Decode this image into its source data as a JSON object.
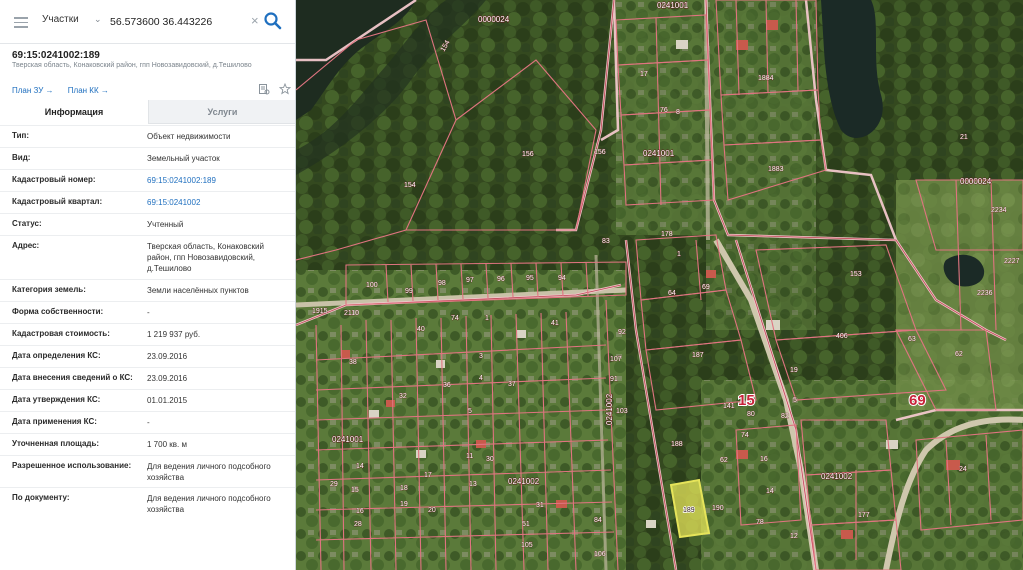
{
  "search": {
    "type_label": "Участки",
    "query": "56.573600 36.443226"
  },
  "object": {
    "cadastral_number": "69:15:0241002:189",
    "address_short": "Тверская область, Конаковский район, гпп Новозавидовский, д.Тешилово"
  },
  "links": {
    "plan_zu": "План ЗУ →",
    "plan_kk": "План КК →"
  },
  "tabs": {
    "info": "Информация",
    "services": "Услуги"
  },
  "info_rows": [
    {
      "label": "Тип:",
      "value": "Объект недвижимости",
      "link": false
    },
    {
      "label": "Вид:",
      "value": "Земельный участок",
      "link": false
    },
    {
      "label": "Кадастровый номер:",
      "value": "69:15:0241002:189",
      "link": true
    },
    {
      "label": "Кадастровый квартал:",
      "value": "69:15:0241002",
      "link": true
    },
    {
      "label": "Статус:",
      "value": "Учтенный",
      "link": false
    },
    {
      "label": "Адрес:",
      "value": "Тверская область, Конаковский район, гпп Новозавидовский, д.Тешилово",
      "link": false
    },
    {
      "label": "Категория земель:",
      "value": "Земли населённых пунктов",
      "link": false
    },
    {
      "label": "Форма собственности:",
      "value": "-",
      "link": false
    },
    {
      "label": "Кадастровая стоимость:",
      "value": "1 219 937 руб.",
      "link": false
    },
    {
      "label": "Дата определения КС:",
      "value": "23.09.2016",
      "link": false
    },
    {
      "label": "Дата внесения сведений о КС:",
      "value": "23.09.2016",
      "link": false
    },
    {
      "label": "Дата утверждения КС:",
      "value": "01.01.2015",
      "link": false
    },
    {
      "label": "Дата применения КС:",
      "value": "-",
      "link": false
    },
    {
      "label": "Уточненная площадь:",
      "value": "1 700 кв. м",
      "link": false
    },
    {
      "label": "Разрешенное использование:",
      "value": "Для ведения личного подсобного хозяйства",
      "link": false
    },
    {
      "label": "По документу:",
      "value": "Для ведения личного подсобного хозяйства",
      "link": false
    }
  ],
  "map": {
    "quarter_labels": [
      "0000024",
      "0241001",
      "0241002",
      "0241001",
      "0241002",
      "0000024",
      "0241001",
      "0241002"
    ],
    "region_labels": [
      "15",
      "69"
    ],
    "selected_parcel_label": "189",
    "parcel_labels": [
      "154",
      "154",
      "156",
      "156",
      "178",
      "83",
      "1",
      "64",
      "69",
      "153",
      "187",
      "188",
      "190",
      "100",
      "99",
      "98",
      "97",
      "96",
      "95",
      "94",
      "2110",
      "1915",
      "40",
      "74",
      "1",
      "41",
      "92",
      "107",
      "91",
      "103",
      "3",
      "4",
      "5",
      "37",
      "36",
      "32",
      "38",
      "11",
      "13",
      "14",
      "15",
      "16",
      "17",
      "18",
      "19",
      "20",
      "28",
      "29",
      "30",
      "31",
      "51",
      "84",
      "105",
      "106",
      "62",
      "61",
      "60",
      "59",
      "58",
      "141",
      "80",
      "74",
      "82",
      "63",
      "62",
      "406",
      "177",
      "24",
      "16",
      "17",
      "14",
      "12",
      "78",
      "1884",
      "1883",
      "2234",
      "2227",
      "2236",
      "17",
      "76",
      "8",
      "21",
      "9",
      "5",
      "1",
      "2"
    ],
    "colors": {
      "parcel_border": "#e07480",
      "quarter_border": "#f2c8cc",
      "selected_fill": "#e6e45a",
      "panel_link": "#1f6fbf"
    }
  }
}
